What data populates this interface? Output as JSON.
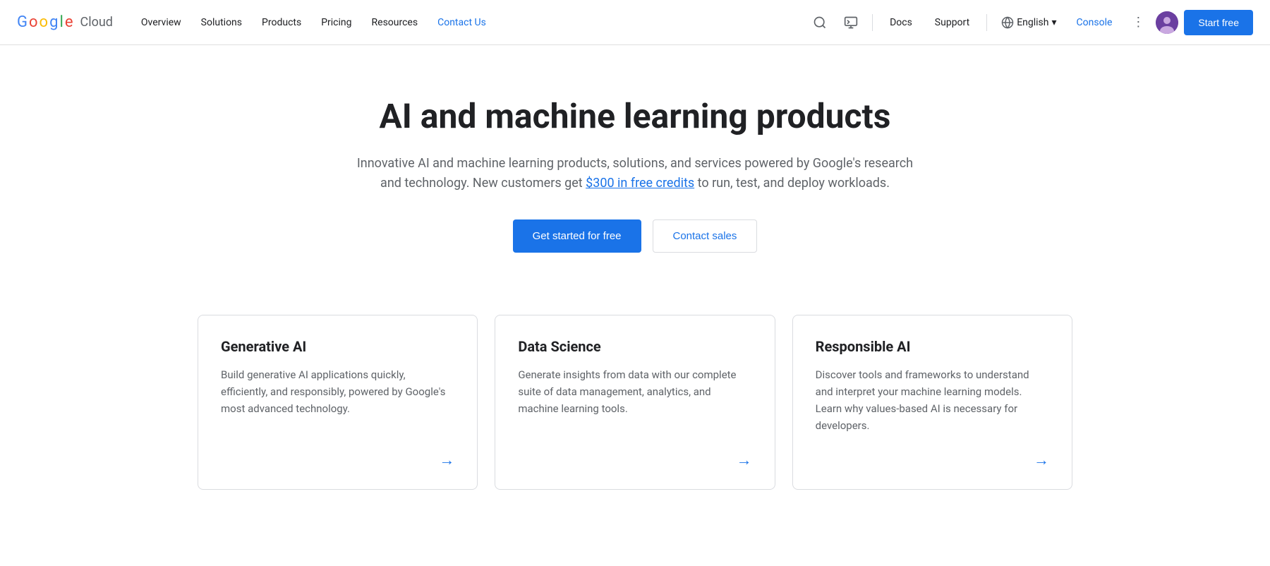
{
  "nav": {
    "logo_google": "Google",
    "logo_cloud": "Cloud",
    "links": [
      {
        "label": "Overview",
        "active": false
      },
      {
        "label": "Solutions",
        "active": false
      },
      {
        "label": "Products",
        "active": false
      },
      {
        "label": "Pricing",
        "active": false
      },
      {
        "label": "Resources",
        "active": false
      },
      {
        "label": "Contact Us",
        "active": true
      }
    ],
    "docs_label": "Docs",
    "support_label": "Support",
    "language_label": "English",
    "console_label": "Console",
    "start_free_label": "Start free"
  },
  "hero": {
    "title": "AI and machine learning products",
    "description_part1": "Innovative AI and machine learning products, solutions, and services powered by Google's research and technology. New customers get ",
    "credits_link": "$300 in free credits",
    "description_part2": " to run, test, and deploy workloads.",
    "btn_primary": "Get started for free",
    "btn_secondary": "Contact sales"
  },
  "cards": [
    {
      "title": "Generative AI",
      "description": "Build generative AI applications quickly, efficiently, and responsibly, powered by Google's most advanced technology.",
      "arrow": "→"
    },
    {
      "title": "Data Science",
      "description": "Generate insights from data with our complete suite of data management, analytics, and machine learning tools.",
      "arrow": "→"
    },
    {
      "title": "Responsible AI",
      "description": "Discover tools and frameworks to understand and interpret your machine learning models. Learn why values-based AI is necessary for developers.",
      "arrow": "→"
    }
  ]
}
